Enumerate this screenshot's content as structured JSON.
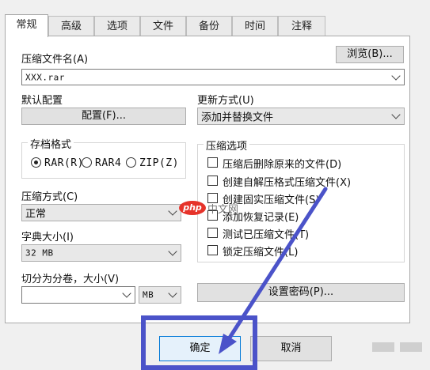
{
  "tabs": [
    "常规",
    "高级",
    "选项",
    "文件",
    "备份",
    "时间",
    "注释"
  ],
  "archive_name_label": "压缩文件名(A)",
  "browse_button": "浏览(B)...",
  "archive_name_value": "XXX.rar",
  "default_profile_label": "默认配置",
  "profile_button": "配置(F)...",
  "update_mode_label": "更新方式(U)",
  "update_mode_value": "添加并替换文件",
  "archive_format": {
    "legend": "存档格式",
    "options": [
      "RAR(R)",
      "RAR4",
      "ZIP(Z)"
    ],
    "selected": "RAR(R)"
  },
  "compression_method_label": "压缩方式(C)",
  "compression_method_value": "正常",
  "dictionary_size_label": "字典大小(I)",
  "dictionary_size_value": "32 MB",
  "split_label": "切分为分卷，大小(V)",
  "split_value": "",
  "split_unit": "MB",
  "compression_options": {
    "legend": "压缩选项",
    "items": [
      {
        "label": "压缩后删除原来的文件(D)",
        "checked": false
      },
      {
        "label": "创建自解压格式压缩文件(X)",
        "checked": false
      },
      {
        "label": "创建固实压缩文件(S)",
        "checked": false
      },
      {
        "label": "添加恢复记录(E)",
        "checked": false
      },
      {
        "label": "测试已压缩文件(T)",
        "checked": false
      },
      {
        "label": "锁定压缩文件(L)",
        "checked": false
      }
    ]
  },
  "set_password_button": "设置密码(P)...",
  "ok_button": "确定",
  "cancel_button": "取消",
  "watermark": "php中文网",
  "colors": {
    "highlight": "#4b53c9",
    "arrow": "#4b53c9"
  }
}
